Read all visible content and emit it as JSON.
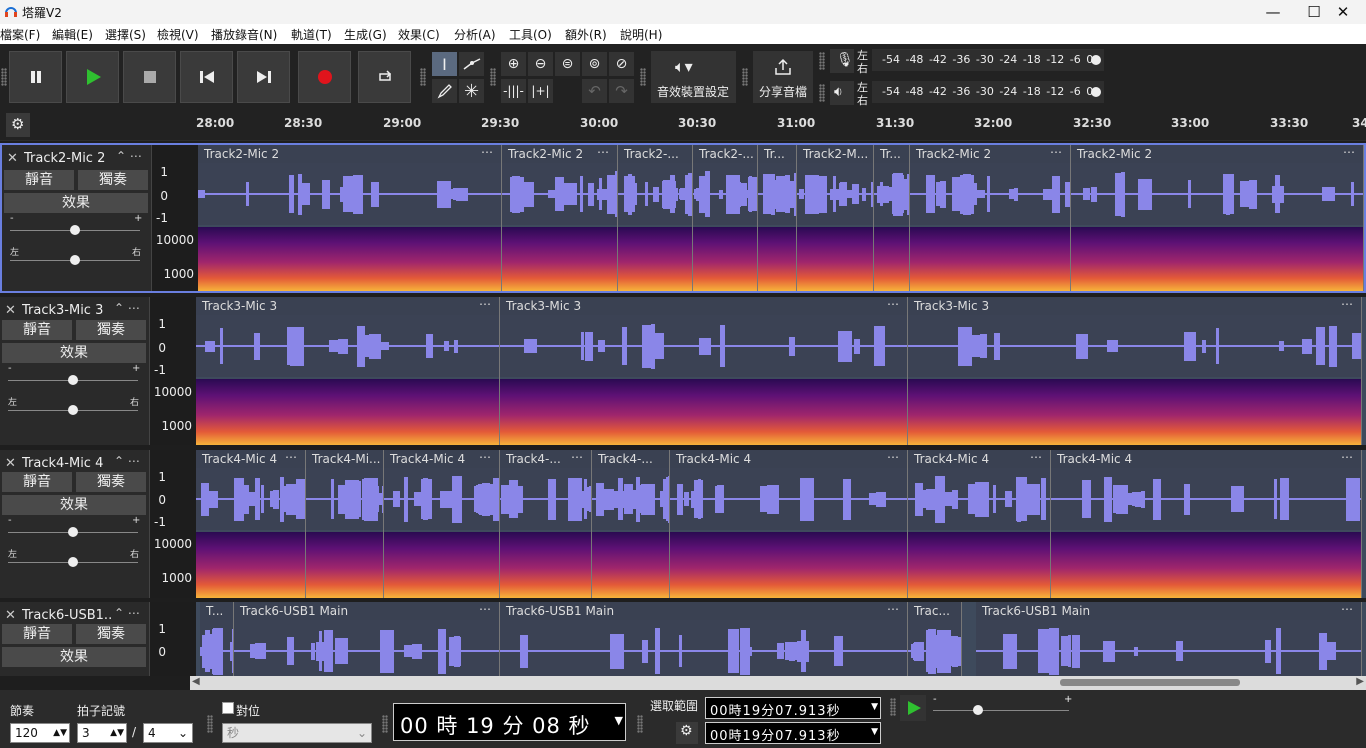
{
  "window": {
    "title": "塔羅V2",
    "controls": [
      "—",
      "☐",
      "✕"
    ]
  },
  "menu": [
    "檔案(F)",
    "編輯(E)",
    "選擇(S)",
    "檢視(V)",
    "播放錄音(N)",
    "軌道(T)",
    "生成(G)",
    "效果(C)",
    "分析(A)",
    "工具(O)",
    "額外(R)",
    "說明(H)"
  ],
  "toolbar": {
    "audio_setup_label": "音效裝置設定",
    "share_label": "分享音檔",
    "meter_lr": {
      "left": "左",
      "right": "右"
    },
    "meter_scale": [
      "-54",
      "-48",
      "-42",
      "-36",
      "-30",
      "-24",
      "-18",
      "-12",
      "-6",
      "0"
    ]
  },
  "ruler": {
    "ticks": [
      "28:00",
      "28:30",
      "29:00",
      "29:30",
      "30:00",
      "30:30",
      "31:00",
      "31:30",
      "32:00",
      "32:30",
      "33:00",
      "33:30",
      "34"
    ]
  },
  "tracks": [
    {
      "name": "Track2-Mic 2",
      "mute": "靜音",
      "solo": "獨奏",
      "effects": "效果",
      "pan_l": "左",
      "pan_r": "右",
      "gain_minus": "-",
      "gain_plus": "+",
      "scale": {
        "y1": "1",
        "y0": "0",
        "ym1": "-1",
        "s10000": "10000",
        "s1000": "1000"
      },
      "clips": [
        "Track2-Mic 2",
        "Track2-Mic 2",
        "Track2-...",
        "Track2-...",
        "Tr...",
        "Track2-M...",
        "Tr...",
        "Track2-Mic 2",
        "Track2-Mic 2"
      ]
    },
    {
      "name": "Track3-Mic 3",
      "mute": "靜音",
      "solo": "獨奏",
      "effects": "效果",
      "pan_l": "左",
      "pan_r": "右",
      "gain_minus": "-",
      "gain_plus": "+",
      "scale": {
        "y1": "1",
        "y0": "0",
        "ym1": "-1",
        "s10000": "10000",
        "s1000": "1000"
      },
      "clips": [
        "Track3-Mic 3",
        "Track3-Mic 3",
        "Track3-Mic 3"
      ]
    },
    {
      "name": "Track4-Mic 4",
      "mute": "靜音",
      "solo": "獨奏",
      "effects": "效果",
      "pan_l": "左",
      "pan_r": "右",
      "gain_minus": "-",
      "gain_plus": "+",
      "scale": {
        "y1": "1",
        "y0": "0",
        "ym1": "-1",
        "s10000": "10000",
        "s1000": "1000"
      },
      "clips": [
        "Track4-Mic 4",
        "Track4-Mi...",
        "Track4-Mic 4",
        "Track4-...",
        "Track4-...",
        "Track4-Mic 4",
        "Track4-Mic 4",
        "Track4-Mic 4"
      ]
    },
    {
      "name": "Track6-USB1...",
      "mute": "靜音",
      "solo": "獨奏",
      "effects": "效果",
      "scale": {
        "y1": "1",
        "y0": "0"
      },
      "clips": [
        "T...",
        "Track6-USB1 Main",
        "Track6-USB1 Main",
        "Trac...",
        "Track6-USB1 Main"
      ]
    }
  ],
  "bottom": {
    "tempo_label": "節奏",
    "tempo_value": "120",
    "timesig_label": "拍子記號",
    "timesig_num": "3",
    "timesig_sep": "/",
    "timesig_den": "4",
    "snap_label": "對位",
    "snap_unit": "秒",
    "time_display": "00 時 19 分 08 秒",
    "selection_label": "選取範圍",
    "sel_start": "00時19分07.913秒",
    "sel_end": "00時19分07.913秒",
    "speed_minus": "-",
    "speed_plus": "+"
  }
}
